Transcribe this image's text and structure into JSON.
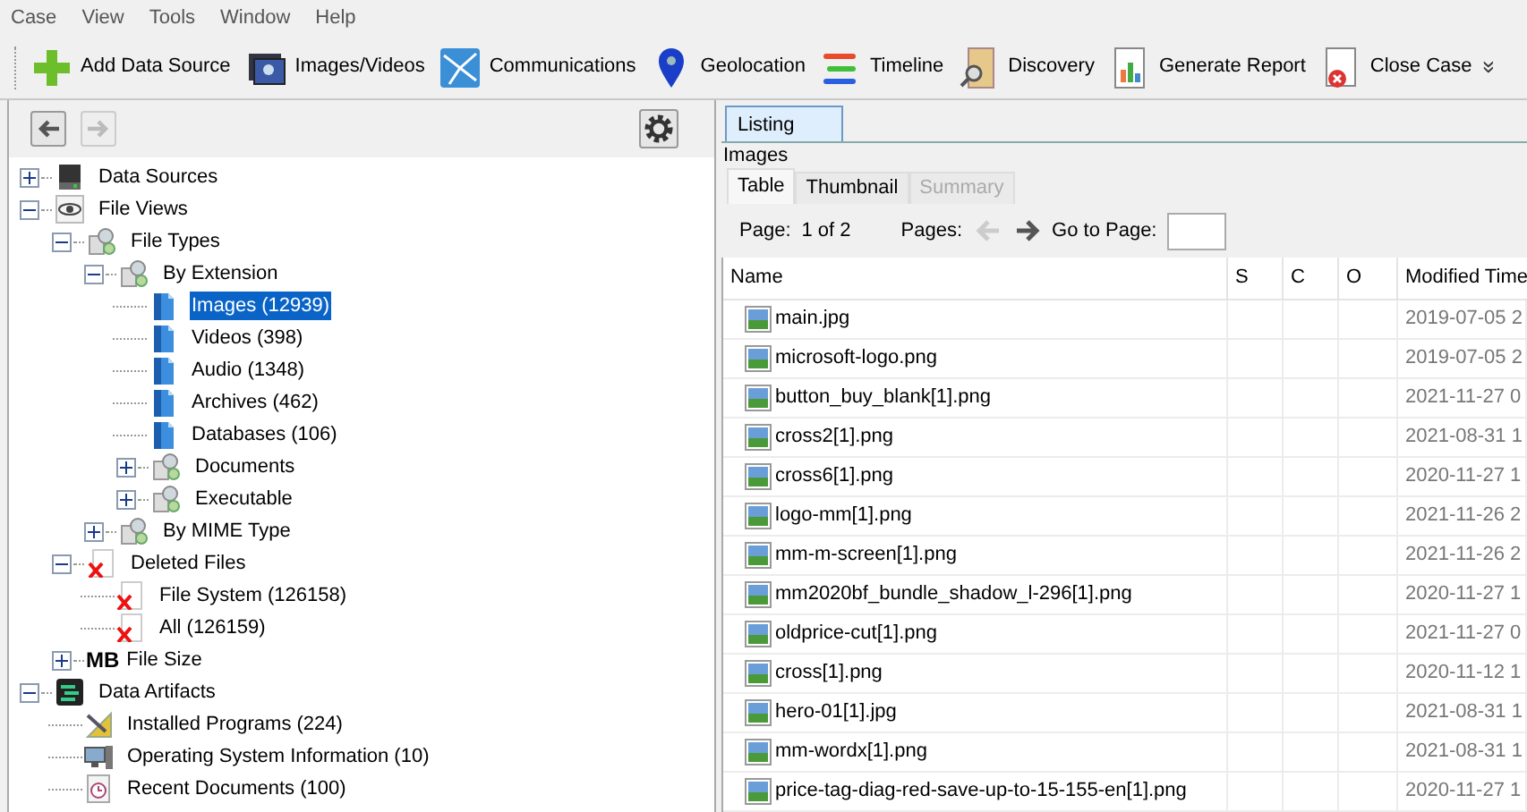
{
  "menu": [
    "Case",
    "View",
    "Tools",
    "Window",
    "Help"
  ],
  "toolbar": [
    {
      "label": "Add Data Source",
      "kind": "add"
    },
    {
      "label": "Images/Videos",
      "kind": "images"
    },
    {
      "label": "Communications",
      "kind": "comms"
    },
    {
      "label": "Geolocation",
      "kind": "geo"
    },
    {
      "label": "Timeline",
      "kind": "timeline"
    },
    {
      "label": "Discovery",
      "kind": "discovery"
    },
    {
      "label": "Generate Report",
      "kind": "report"
    },
    {
      "label": "Close Case",
      "kind": "close"
    }
  ],
  "toolbar_more": "»",
  "nav": {
    "back_enabled": true,
    "forward_enabled": false
  },
  "tree": [
    {
      "label": "Data Sources",
      "kind": "drive",
      "expanded": false,
      "selected": false
    },
    {
      "label": "File Views",
      "kind": "eye",
      "expanded": true,
      "selected": false,
      "children": [
        {
          "label": "File Types",
          "kind": "filetype",
          "expanded": true,
          "selected": false,
          "children": [
            {
              "label": "By Extension",
              "kind": "filetype",
              "expanded": true,
              "selected": false,
              "children": [
                {
                  "label": "Images (12939)",
                  "kind": "doc",
                  "selected": true
                },
                {
                  "label": "Videos (398)",
                  "kind": "doc",
                  "selected": false
                },
                {
                  "label": "Audio (1348)",
                  "kind": "doc",
                  "selected": false
                },
                {
                  "label": "Archives (462)",
                  "kind": "doc",
                  "selected": false
                },
                {
                  "label": "Databases (106)",
                  "kind": "doc",
                  "selected": false
                },
                {
                  "label": "Documents",
                  "kind": "filetype",
                  "expanded": false,
                  "selected": false
                },
                {
                  "label": "Executable",
                  "kind": "filetype",
                  "expanded": false,
                  "selected": false
                }
              ]
            },
            {
              "label": "By MIME Type",
              "kind": "filetype",
              "expanded": false,
              "selected": false
            }
          ]
        },
        {
          "label": "Deleted Files",
          "kind": "deleted",
          "expanded": true,
          "selected": false,
          "children": [
            {
              "label": "File System (126158)",
              "kind": "deleted",
              "selected": false
            },
            {
              "label": "All (126159)",
              "kind": "deleted",
              "selected": false
            }
          ]
        },
        {
          "label": "File Size",
          "kind": "size",
          "badge": "MB",
          "expanded": false,
          "selected": false
        }
      ]
    },
    {
      "label": "Data Artifacts",
      "kind": "artifacts",
      "expanded": true,
      "selected": false,
      "children": [
        {
          "label": "Installed Programs (224)",
          "kind": "programs",
          "selected": false
        },
        {
          "label": "Operating System Information (10)",
          "kind": "os",
          "selected": false
        },
        {
          "label": "Recent Documents (100)",
          "kind": "recent",
          "selected": false
        }
      ]
    }
  ],
  "panel_tab": {
    "label": "Listing",
    "selected": true
  },
  "listing_title": "Images",
  "view_tabs": [
    {
      "label": "Table",
      "selected": true,
      "disabled": false
    },
    {
      "label": "Thumbnail",
      "selected": false,
      "disabled": false
    },
    {
      "label": "Summary",
      "selected": false,
      "disabled": true
    }
  ],
  "paging": {
    "page_label": "Page:",
    "page_value": "1 of 2",
    "pages_label": "Pages:",
    "prev_enabled": false,
    "next_enabled": true,
    "goto_label": "Go to Page:"
  },
  "table": {
    "columns": [
      "Name",
      "S",
      "C",
      "O",
      "Modified Time"
    ],
    "rows": [
      [
        "main.jpg",
        "",
        "",
        "",
        "2019-07-05 2"
      ],
      [
        "microsoft-logo.png",
        "",
        "",
        "",
        "2019-07-05 2"
      ],
      [
        "button_buy_blank[1].png",
        "",
        "",
        "",
        "2021-11-27 0"
      ],
      [
        "cross2[1].png",
        "",
        "",
        "",
        "2021-08-31 1"
      ],
      [
        "cross6[1].png",
        "",
        "",
        "",
        "2020-11-27 1"
      ],
      [
        "logo-mm[1].png",
        "",
        "",
        "",
        "2021-11-26 2"
      ],
      [
        "mm-m-screen[1].png",
        "",
        "",
        "",
        "2021-11-26 2"
      ],
      [
        "mm2020bf_bundle_shadow_l-296[1].png",
        "",
        "",
        "",
        "2020-11-27 1"
      ],
      [
        "oldprice-cut[1].png",
        "",
        "",
        "",
        "2021-11-27 0"
      ],
      [
        "cross[1].png",
        "",
        "",
        "",
        "2020-11-12 1"
      ],
      [
        "hero-01[1].jpg",
        "",
        "",
        "",
        "2021-08-31 1"
      ],
      [
        "mm-wordx[1].png",
        "",
        "",
        "",
        "2021-08-31 1"
      ],
      [
        "price-tag-diag-red-save-up-to-15-155-en[1].png",
        "",
        "",
        "",
        "2020-11-27 1"
      ]
    ]
  }
}
